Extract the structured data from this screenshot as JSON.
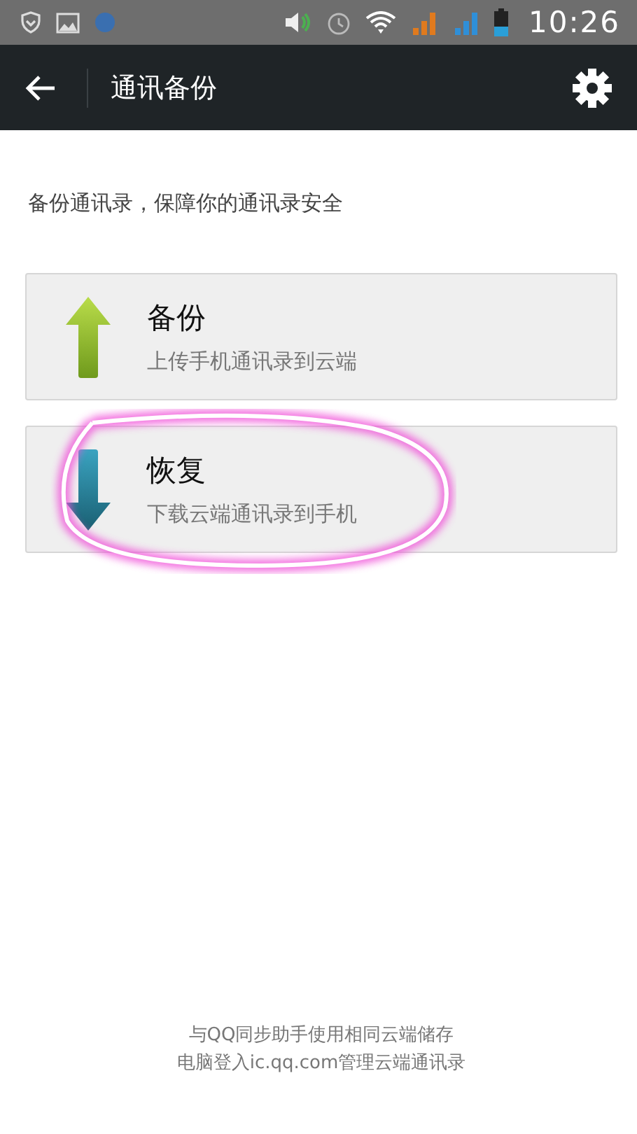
{
  "status_bar": {
    "time": "10:26"
  },
  "header": {
    "title": "通讯备份"
  },
  "description": "备份通讯录，保障你的通讯录安全",
  "actions": [
    {
      "kind": "upload",
      "title": "备份",
      "subtitle": "上传手机通讯录到云端",
      "highlighted": false
    },
    {
      "kind": "download",
      "title": "恢复",
      "subtitle": "下载云端通讯录到手机",
      "highlighted": true
    }
  ],
  "footer": [
    "与QQ同步助手使用相同云端储存",
    "电脑登入ic.qq.com管理云端通讯录"
  ]
}
